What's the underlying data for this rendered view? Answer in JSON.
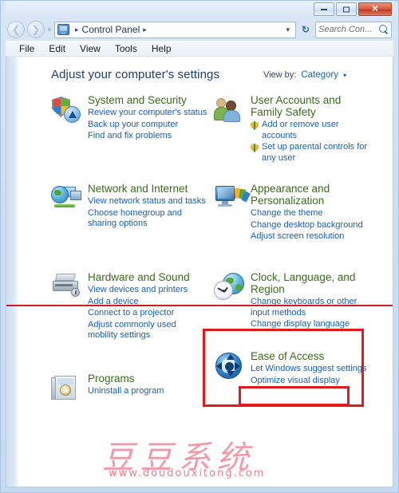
{
  "window": {
    "minimize_label": "Minimize",
    "maximize_label": "Maximize",
    "close_label": "Close"
  },
  "address_bar": {
    "back_label": "Back",
    "forward_label": "Forward",
    "icon": "control-panel-icon",
    "crumb_root": "Control Panel",
    "separator": "▸",
    "dropdown": "▾",
    "refresh": "↻"
  },
  "search": {
    "placeholder": "Search Con...",
    "icon": "search-icon"
  },
  "menubar": {
    "items": [
      "File",
      "Edit",
      "View",
      "Tools",
      "Help"
    ]
  },
  "page": {
    "title": "Adjust your computer's settings",
    "view_by_label": "View by:",
    "view_by_value": "Category",
    "view_by_caret": "▾"
  },
  "categories": [
    {
      "id": "system-and-security",
      "icon": "shield-disc-icon",
      "title": "System and Security",
      "tasks": [
        {
          "label": "Review your computer's status",
          "shield": false
        },
        {
          "label": "Back up your computer",
          "shield": false
        },
        {
          "label": "Find and fix problems",
          "shield": false
        }
      ]
    },
    {
      "id": "user-accounts-and-family-safety",
      "icon": "users-icon",
      "title": "User Accounts and Family Safety",
      "tasks": [
        {
          "label": "Add or remove user accounts",
          "shield": true
        },
        {
          "label": "Set up parental controls for any user",
          "shield": true
        }
      ]
    },
    {
      "id": "network-and-internet",
      "icon": "globe-monitors-icon",
      "title": "Network and Internet",
      "tasks": [
        {
          "label": "View network status and tasks",
          "shield": false
        },
        {
          "label": "Choose homegroup and sharing options",
          "shield": false
        }
      ]
    },
    {
      "id": "appearance-and-personalization",
      "icon": "monitor-palette-icon",
      "title": "Appearance and Personalization",
      "tasks": [
        {
          "label": "Change the theme",
          "shield": false
        },
        {
          "label": "Change desktop background",
          "shield": false
        },
        {
          "label": "Adjust screen resolution",
          "shield": false
        }
      ]
    },
    {
      "id": "hardware-and-sound",
      "icon": "printer-icon",
      "title": "Hardware and Sound",
      "tasks": [
        {
          "label": "View devices and printers",
          "shield": false
        },
        {
          "label": "Add a device",
          "shield": false
        },
        {
          "label": "Connect to a projector",
          "shield": false
        },
        {
          "label": "Adjust commonly used mobility settings",
          "shield": false
        }
      ]
    },
    {
      "id": "clock-language-and-region",
      "icon": "clock-globe-icon",
      "title": "Clock, Language, and Region",
      "tasks": [
        {
          "label": "Change keyboards or other input methods",
          "shield": false
        },
        {
          "label": "Change display language",
          "shield": false
        }
      ]
    },
    {
      "id": "programs",
      "icon": "programs-box-icon",
      "title": "Programs",
      "tasks": [
        {
          "label": "Uninstall a program",
          "shield": false
        }
      ]
    },
    {
      "id": "ease-of-access",
      "icon": "ease-of-access-icon",
      "title": "Ease of Access",
      "tasks": [
        {
          "label": "Let Windows suggest settings",
          "shield": false
        },
        {
          "label": "Optimize visual display",
          "shield": false
        }
      ]
    }
  ],
  "annotations": {
    "line_color": "#cf1d1d",
    "box_color": "#e01b1b",
    "highlight_outer": "clock-language-and-region",
    "highlight_inner": "Change display language"
  },
  "watermark": {
    "brand": "豆豆系统",
    "url": "www.doudouxitong.com",
    "color": "#f08a9e"
  }
}
